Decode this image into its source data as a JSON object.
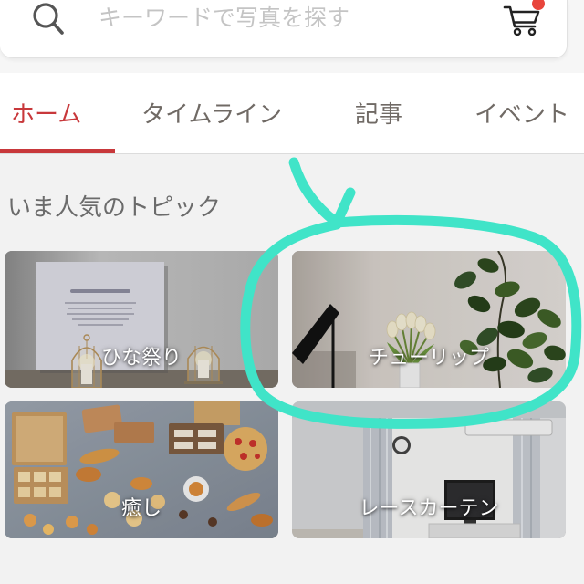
{
  "header": {
    "search": {
      "placeholder": "キーワードで写真を探す",
      "icon": "search-icon"
    },
    "cart": {
      "icon": "cart-icon",
      "badge_icon": "notification-dot-icon"
    }
  },
  "tabs": [
    {
      "label": "ホーム",
      "active": true
    },
    {
      "label": "タイムライン",
      "active": false
    },
    {
      "label": "記事",
      "active": false
    },
    {
      "label": "イベント",
      "active": false
    }
  ],
  "popular_topics": {
    "title": "いま人気のトピック",
    "items": [
      {
        "label": "ひな祭り"
      },
      {
        "label": "チューリップ"
      },
      {
        "label": "癒し"
      },
      {
        "label": "レースカーテン"
      }
    ]
  },
  "colors": {
    "accent": "#c8383b",
    "tab_inactive": "#706a65",
    "placeholder": "#c4c4c4",
    "section_title": "#6b6b6b",
    "section_background": "#f2f2f2",
    "cart_badge": "#e8453c",
    "annotation": "#40e4c8"
  }
}
